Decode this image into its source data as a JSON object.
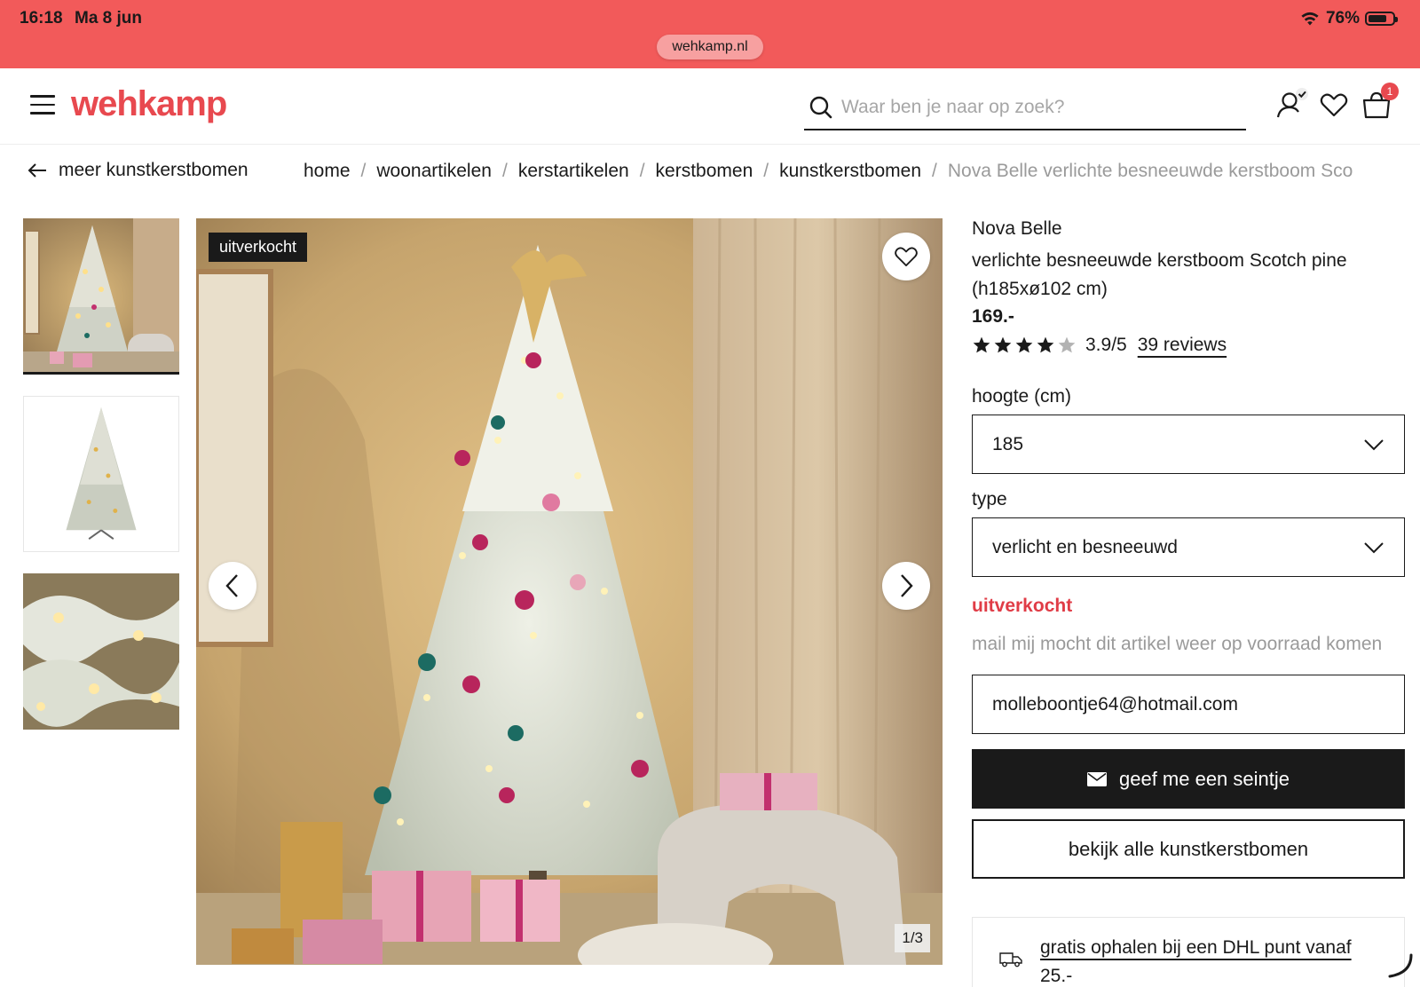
{
  "status_bar": {
    "time": "16:18",
    "date": "Ma 8 jun",
    "battery": "76%",
    "url": "wehkamp.nl",
    "color": "#f25a5a"
  },
  "header": {
    "logo": "wehkamp",
    "search_placeholder": "Waar ben je naar op zoek?",
    "cart_count": "1",
    "brand_color": "#e8494f"
  },
  "nav": {
    "back_label": "meer kunstkerstbomen",
    "breadcrumb": [
      "home",
      "woonartikelen",
      "kerstartikelen",
      "kerstbomen",
      "kunstkerstbomen"
    ],
    "breadcrumb_current": "Nova Belle verlichte besneeuwde kerstboom Sco",
    "separator": "/"
  },
  "gallery": {
    "badge": "uitverkocht",
    "counter": "1/3"
  },
  "product": {
    "brand": "Nova Belle",
    "title": "verlichte besneeuwde kerstboom Scotch pine (h185xø102 cm)",
    "price": "169.-",
    "rating_value": 3.9,
    "rating": "3.9/5",
    "reviews": "39 reviews",
    "height_label": "hoogte (cm)",
    "height_value": "185",
    "type_label": "type",
    "type_value": "verlicht en besneeuwd",
    "stock_status": "uitverkocht",
    "notify_text": "mail mij mocht dit artikel weer op voorraad komen",
    "email_value": "molleboontje64@hotmail.com",
    "notify_button": "geef me een seintje",
    "all_button": "bekijk alle kunstkerstbomen",
    "delivery_text": "gratis ophalen bij een DHL punt vanaf 25.-"
  }
}
